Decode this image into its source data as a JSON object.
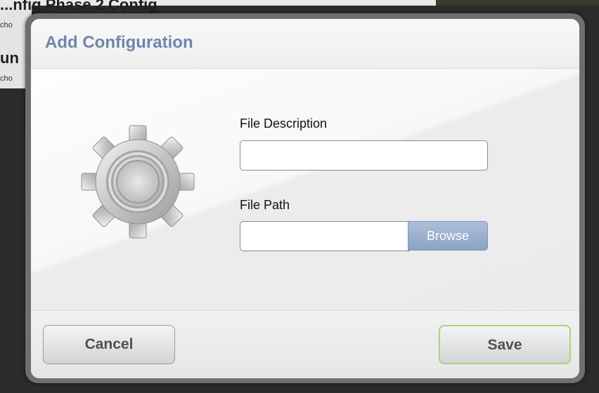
{
  "background": {
    "title_1": "...nfig Phase 2 Config",
    "sub_1": "cho",
    "title_2": "un",
    "sub_2": "cho"
  },
  "modal": {
    "title": "Add Configuration",
    "icon": "gear-icon",
    "fields": {
      "file_description": {
        "label": "File Description",
        "value": "",
        "placeholder": ""
      },
      "file_path": {
        "label": "File Path",
        "value": "",
        "placeholder": ""
      }
    },
    "browse_label": "Browse",
    "cancel_label": "Cancel",
    "save_label": "Save"
  },
  "colors": {
    "title": "#6f86a9",
    "browse": "#8aa2c4",
    "save_border": "#a7d47c"
  }
}
